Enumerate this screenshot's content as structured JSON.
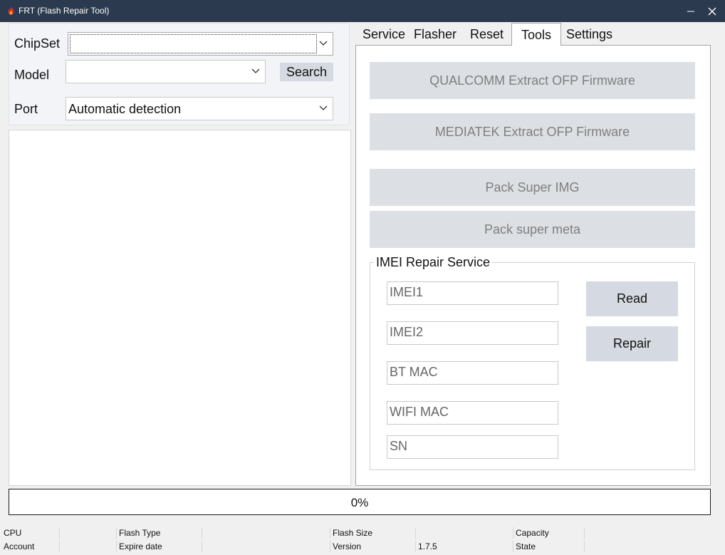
{
  "window": {
    "title": "FRT (Flash Repair Tool)",
    "minimize_glyph": "—",
    "close_glyph": "✕",
    "icon": "app-flame-icon"
  },
  "left_panel": {
    "chipset_label": "ChipSet",
    "chipset_value": "",
    "model_label": "Model",
    "model_value": "",
    "search_label": "Search",
    "port_label": "Port",
    "port_value": "Automatic detection"
  },
  "tabs": [
    {
      "label": "Service",
      "active": false
    },
    {
      "label": "Flasher",
      "active": false
    },
    {
      "label": "Reset",
      "active": false
    },
    {
      "label": "Tools",
      "active": true
    },
    {
      "label": "Settings",
      "active": false
    }
  ],
  "tools": {
    "buttons": [
      {
        "label": "QUALCOMM Extract OFP Firmware"
      },
      {
        "label": "MEDIATEK Extract OFP Firmware"
      },
      {
        "label": "Pack Super IMG"
      },
      {
        "label": "Pack super meta"
      }
    ],
    "imei_group": {
      "title": "IMEI Repair Service",
      "fields": [
        {
          "placeholder": "IMEI1"
        },
        {
          "placeholder": "IMEI2"
        },
        {
          "placeholder": "BT MAC"
        },
        {
          "placeholder": "WIFI MAC"
        },
        {
          "placeholder": "SN"
        }
      ],
      "read_label": "Read",
      "repair_label": "Repair"
    }
  },
  "progress": {
    "value": 0,
    "text": "0%"
  },
  "status": {
    "row1": {
      "cpu_label": "CPU",
      "flash_type_label": "Flash Type",
      "flash_size_label": "Flash Size",
      "capacity_label": "Capacity"
    },
    "row2": {
      "account_label": "Account",
      "expire_label": "Expire date",
      "version_label": "Version",
      "version_value": "1.7.5",
      "state_label": "State"
    }
  },
  "colors": {
    "titlebar": "#2b3a4f",
    "disabled_button_bg": "#dcdfe4",
    "disabled_button_text": "#7f7f7f",
    "action_button_bg": "#d5d9e1"
  }
}
